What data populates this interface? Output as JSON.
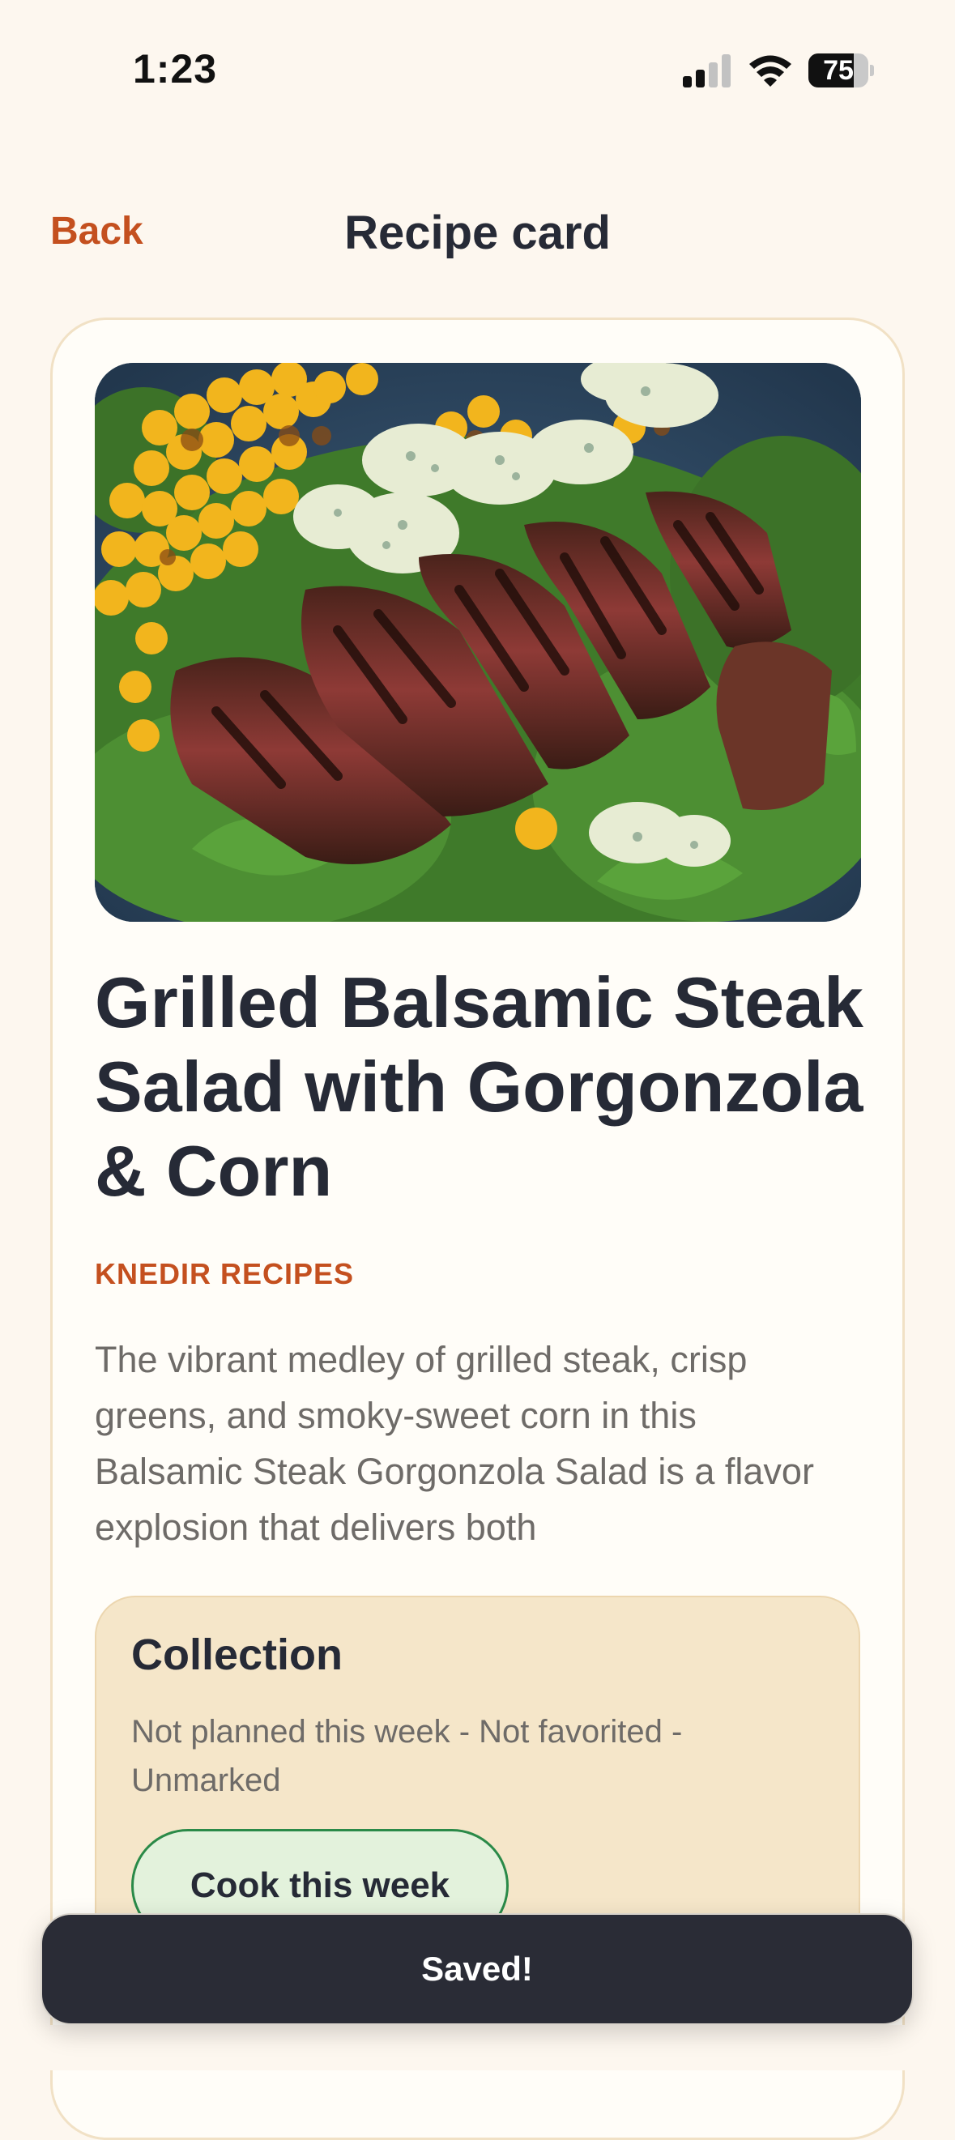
{
  "status_bar": {
    "time": "1:23",
    "battery_percent": "75",
    "battery_level": 0.75,
    "signal_bars": 2,
    "icons": [
      "cellular-signal-icon",
      "wifi-icon",
      "battery-icon"
    ]
  },
  "nav": {
    "back_label": "Back",
    "title": "Recipe card"
  },
  "recipe": {
    "title": "Grilled Balsamic Steak Salad with Gorgonzola & Corn",
    "source": "KNEDIR RECIPES",
    "description": "The vibrant medley of grilled steak, crisp greens, and smoky-sweet corn in this Balsamic Steak Gorgonzola Salad is a flavor explosion that delivers both"
  },
  "collection": {
    "title": "Collection",
    "status": "Not planned this week - Not favorited - Unmarked",
    "cook_button_label": "Cook this week"
  },
  "toast": {
    "message": "Saved!"
  },
  "colors": {
    "accent": "#c4501f",
    "background": "#fdf7ef",
    "text_dark": "#262a36",
    "collection_bg": "#f5e6c9",
    "cook_button_border": "#2a8a48",
    "toast_bg": "#2a2c36"
  }
}
